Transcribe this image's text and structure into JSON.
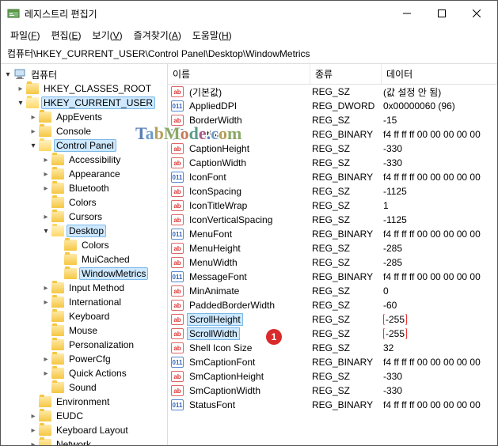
{
  "window": {
    "title": "레지스트리 편집기"
  },
  "menubar": {
    "file": "파일",
    "file_u": "F",
    "edit": "편집",
    "edit_u": "E",
    "view": "보기",
    "view_u": "V",
    "fav": "즐겨찾기",
    "fav_u": "A",
    "help": "도움말",
    "help_u": "H"
  },
  "path": "컴퓨터\\HKEY_CURRENT_USER\\Control Panel\\Desktop\\WindowMetrics",
  "tree": {
    "root": "컴퓨터",
    "hkcr": "HKEY_CLASSES_ROOT",
    "hkcu": "HKEY_CURRENT_USER",
    "appevents": "AppEvents",
    "console": "Console",
    "cpanel": "Control Panel",
    "accessibility": "Accessibility",
    "appearance": "Appearance",
    "bluetooth": "Bluetooth",
    "colors": "Colors",
    "cursors": "Cursors",
    "desktop": "Desktop",
    "desktop_colors": "Colors",
    "muicached": "MuiCached",
    "windowmetrics": "WindowMetrics",
    "inputmethod": "Input Method",
    "international": "International",
    "keyboard": "Keyboard",
    "mouse": "Mouse",
    "personalization": "Personalization",
    "powercfg": "PowerCfg",
    "quickactions": "Quick Actions",
    "sound": "Sound",
    "environment": "Environment",
    "eudc": "EUDC",
    "keyboardlayout": "Keyboard Layout",
    "network": "Network"
  },
  "list": {
    "header": {
      "name": "이름",
      "type": "종류",
      "data": "데이터"
    },
    "rows": [
      {
        "name": "(기본값)",
        "type": "REG_SZ",
        "data": "(값 설정 안 됨)",
        "ico": "sz"
      },
      {
        "name": "AppliedDPI",
        "type": "REG_DWORD",
        "data": "0x00000060 (96)",
        "ico": "bin"
      },
      {
        "name": "BorderWidth",
        "type": "REG_SZ",
        "data": "-15",
        "ico": "sz"
      },
      {
        "name": "CaptionFont",
        "type": "REG_BINARY",
        "data": "f4 ff ff ff 00 00 00 00 00",
        "ico": "bin"
      },
      {
        "name": "CaptionHeight",
        "type": "REG_SZ",
        "data": "-330",
        "ico": "sz"
      },
      {
        "name": "CaptionWidth",
        "type": "REG_SZ",
        "data": "-330",
        "ico": "sz"
      },
      {
        "name": "IconFont",
        "type": "REG_BINARY",
        "data": "f4 ff ff ff 00 00 00 00 00",
        "ico": "bin"
      },
      {
        "name": "IconSpacing",
        "type": "REG_SZ",
        "data": "-1125",
        "ico": "sz"
      },
      {
        "name": "IconTitleWrap",
        "type": "REG_SZ",
        "data": "1",
        "ico": "sz"
      },
      {
        "name": "IconVerticalSpacing",
        "type": "REG_SZ",
        "data": "-1125",
        "ico": "sz"
      },
      {
        "name": "MenuFont",
        "type": "REG_BINARY",
        "data": "f4 ff ff ff 00 00 00 00 00",
        "ico": "bin"
      },
      {
        "name": "MenuHeight",
        "type": "REG_SZ",
        "data": "-285",
        "ico": "sz"
      },
      {
        "name": "MenuWidth",
        "type": "REG_SZ",
        "data": "-285",
        "ico": "sz"
      },
      {
        "name": "MessageFont",
        "type": "REG_BINARY",
        "data": "f4 ff ff ff 00 00 00 00 00",
        "ico": "bin"
      },
      {
        "name": "MinAnimate",
        "type": "REG_SZ",
        "data": "0",
        "ico": "sz"
      },
      {
        "name": "PaddedBorderWidth",
        "type": "REG_SZ",
        "data": "-60",
        "ico": "sz"
      },
      {
        "name": "ScrollHeight",
        "type": "REG_SZ",
        "data": "-255",
        "ico": "sz",
        "sel": true,
        "hl": true
      },
      {
        "name": "ScrollWidth",
        "type": "REG_SZ",
        "data": "-255",
        "ico": "sz",
        "sel": true,
        "hl": true
      },
      {
        "name": "Shell Icon Size",
        "type": "REG_SZ",
        "data": "32",
        "ico": "sz"
      },
      {
        "name": "SmCaptionFont",
        "type": "REG_BINARY",
        "data": "f4 ff ff ff 00 00 00 00 00",
        "ico": "bin"
      },
      {
        "name": "SmCaptionHeight",
        "type": "REG_SZ",
        "data": "-330",
        "ico": "sz"
      },
      {
        "name": "SmCaptionWidth",
        "type": "REG_SZ",
        "data": "-330",
        "ico": "sz"
      },
      {
        "name": "StatusFont",
        "type": "REG_BINARY",
        "data": "f4 ff ff ff 00 00 00 00 00",
        "ico": "bin"
      }
    ]
  },
  "badge": "1",
  "watermark": "TabMode.com"
}
